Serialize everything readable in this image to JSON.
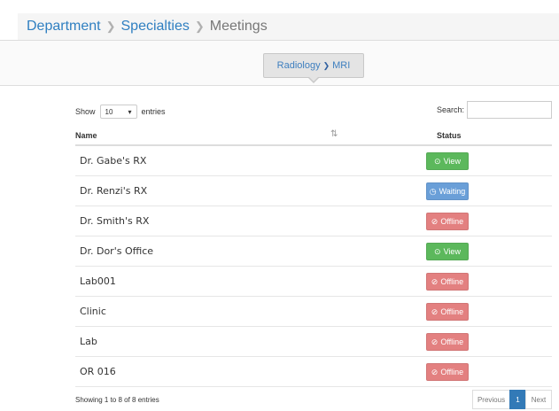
{
  "breadcrumb": {
    "items": [
      "Department",
      "Specialties"
    ],
    "current": "Meetings",
    "separator": "❯"
  },
  "sub_breadcrumb": {
    "parent": "Radiology",
    "child": "MRI",
    "separator": "❯"
  },
  "length_control": {
    "prefix": "Show",
    "value": "10",
    "suffix": "entries"
  },
  "search": {
    "label": "Search:",
    "value": ""
  },
  "table": {
    "columns": [
      "Name",
      "Status"
    ],
    "rows": [
      {
        "name": "Dr. Gabe's RX",
        "status": "View",
        "kind": "view"
      },
      {
        "name": "Dr. Renzi's RX",
        "status": "Waiting",
        "kind": "waiting"
      },
      {
        "name": "Dr. Smith's RX",
        "status": "Offline",
        "kind": "offline"
      },
      {
        "name": "Dr. Dor's Office",
        "status": "View",
        "kind": "view"
      },
      {
        "name": "Lab001",
        "status": "Offline",
        "kind": "offline"
      },
      {
        "name": "Clinic",
        "status": "Offline",
        "kind": "offline"
      },
      {
        "name": "Lab",
        "status": "Offline",
        "kind": "offline"
      },
      {
        "name": "OR 016",
        "status": "Offline",
        "kind": "offline"
      }
    ]
  },
  "footer": {
    "info": "Showing 1 to 8 of 8 entries",
    "pagination": {
      "previous": "Previous",
      "current_page": "1",
      "next": "Next"
    }
  },
  "icons": {
    "view": "check-circle-icon",
    "waiting": "clock-icon",
    "offline": "ban-icon",
    "sort": "sort-icon",
    "dropdown": "caret-down-icon"
  },
  "colors": {
    "link": "#2f7fc1",
    "view": "#5cb85c",
    "waiting": "#6a9fd8",
    "offline": "#e38080",
    "active_page": "#337ab7"
  }
}
